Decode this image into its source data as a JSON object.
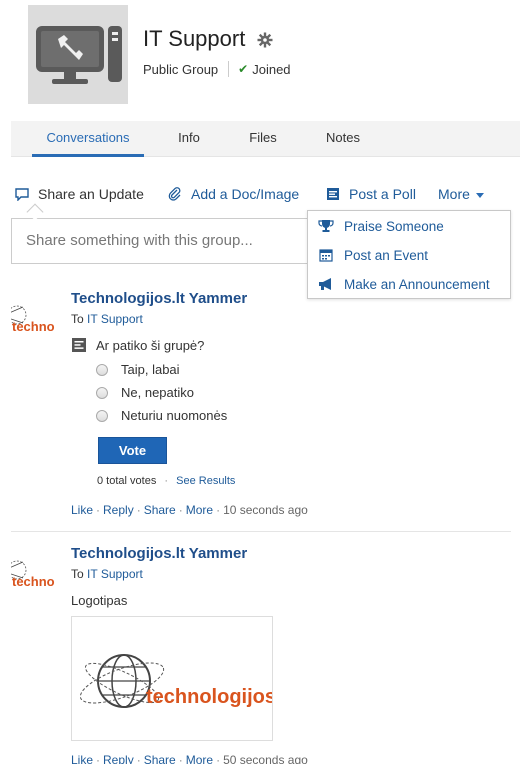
{
  "group": {
    "title": "IT Support",
    "visibility": "Public Group",
    "joined_label": "Joined"
  },
  "tabs": [
    {
      "label": "Conversations",
      "active": true
    },
    {
      "label": "Info",
      "active": false
    },
    {
      "label": "Files",
      "active": false
    },
    {
      "label": "Notes",
      "active": false
    }
  ],
  "publisher": {
    "share_update": "Share an Update",
    "add_doc": "Add a Doc/Image",
    "post_poll": "Post a Poll",
    "more": "More",
    "placeholder": "Share something with this group..."
  },
  "more_menu": [
    {
      "label": "Praise Someone",
      "icon": "trophy-icon"
    },
    {
      "label": "Post an Event",
      "icon": "calendar-icon"
    },
    {
      "label": "Make an Announcement",
      "icon": "megaphone-icon"
    }
  ],
  "posts": [
    {
      "author": "Technologijos.lt Yammer",
      "to_prefix": "To",
      "to_group": "IT Support",
      "avatar_text": "techno",
      "poll": {
        "question": "Ar patiko ši grupė?",
        "options": [
          "Taip, labai",
          "Ne, nepatiko",
          "Neturiu nuomonės"
        ],
        "vote_label": "Vote",
        "total_votes": "0 total votes",
        "see_results": "See Results"
      },
      "actions": [
        "Like",
        "Reply",
        "Share",
        "More"
      ],
      "time": "10 seconds ago"
    },
    {
      "author": "Technologijos.lt Yammer",
      "to_prefix": "To",
      "to_group": "IT Support",
      "avatar_text": "techno",
      "body": "Logotipas",
      "attachment_logo_text": "technologijos.lt",
      "actions": [
        "Like",
        "Reply",
        "Share",
        "More"
      ],
      "time": "50 seconds ago"
    }
  ],
  "colors": {
    "accent": "#2a6cb5",
    "link": "#1f5b99",
    "author": "#1f4e8a",
    "vote_button": "#1f66b6",
    "logo_orange": "#d9541e"
  }
}
